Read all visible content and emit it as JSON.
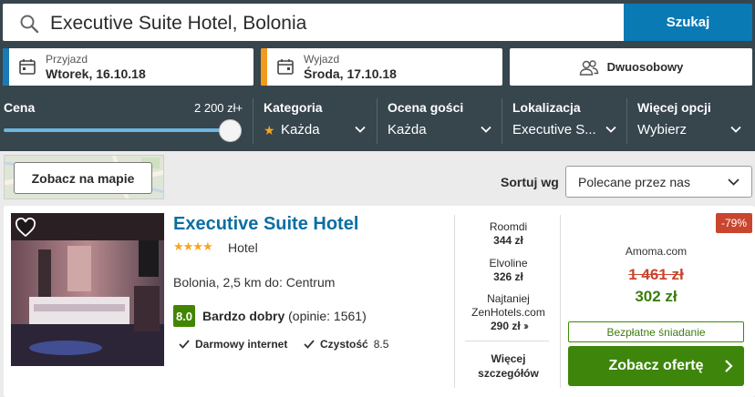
{
  "search": {
    "query": "Executive Suite Hotel, Bolonia",
    "button_label": "Szukaj"
  },
  "dates": {
    "checkin": {
      "label": "Przyjazd",
      "value": "Wtorek, 16.10.18",
      "accent": "#1a7ab3"
    },
    "checkout": {
      "label": "Wyjazd",
      "value": "Środa, 17.10.18",
      "accent": "#f39a1b"
    }
  },
  "room": {
    "label": "Dwuosobowy"
  },
  "filters": {
    "price": {
      "label": "Cena",
      "value": "2 200 zł+",
      "level": 1.0
    },
    "category": {
      "label": "Kategoria",
      "value": "Każda"
    },
    "guest_rating": {
      "label": "Ocena gości",
      "value": "Każda"
    },
    "location": {
      "label": "Lokalizacja",
      "value": "Executive S..."
    },
    "more": {
      "label": "Więcej opcji",
      "value": "Wybierz"
    }
  },
  "map": {
    "button_label": "Zobacz na mapie"
  },
  "sort": {
    "label": "Sortuj wg",
    "value": "Polecane przez nas"
  },
  "hotel": {
    "name": "Executive Suite Hotel",
    "stars": "★★★★",
    "type": "Hotel",
    "location": "Bolonia, 2,5 km do: Centrum",
    "rating": "8.0",
    "rating_label": "Bardzo dobry",
    "rating_count": "(opinie: 1561)",
    "amenities": [
      {
        "label": "Darmowy internet",
        "score": ""
      },
      {
        "label": "Czystość",
        "score": "8.5"
      }
    ]
  },
  "offers": [
    {
      "provider": "Roomdi",
      "price": "344 zł"
    },
    {
      "provider": "Elvoline",
      "price": "326 zł"
    },
    {
      "provider_line1": "Najtaniej",
      "provider_line2": "ZenHotels.com",
      "price": "290 zł"
    }
  ],
  "more_details": {
    "line1": "Więcej",
    "line2": "szczegółów"
  },
  "deal": {
    "discount": "-79%",
    "provider": "Amoma.com",
    "old_price": "1 461 zł",
    "new_price": "302 zł",
    "breakfast": "Bezpłatne śniadanie",
    "cta_label": "Zobacz ofertę"
  },
  "colors": {
    "header_bg": "#37454d",
    "accent_blue": "#0a7ab5",
    "green": "#3d860b",
    "red": "#c9452e",
    "title_blue": "#0a6ea3"
  }
}
